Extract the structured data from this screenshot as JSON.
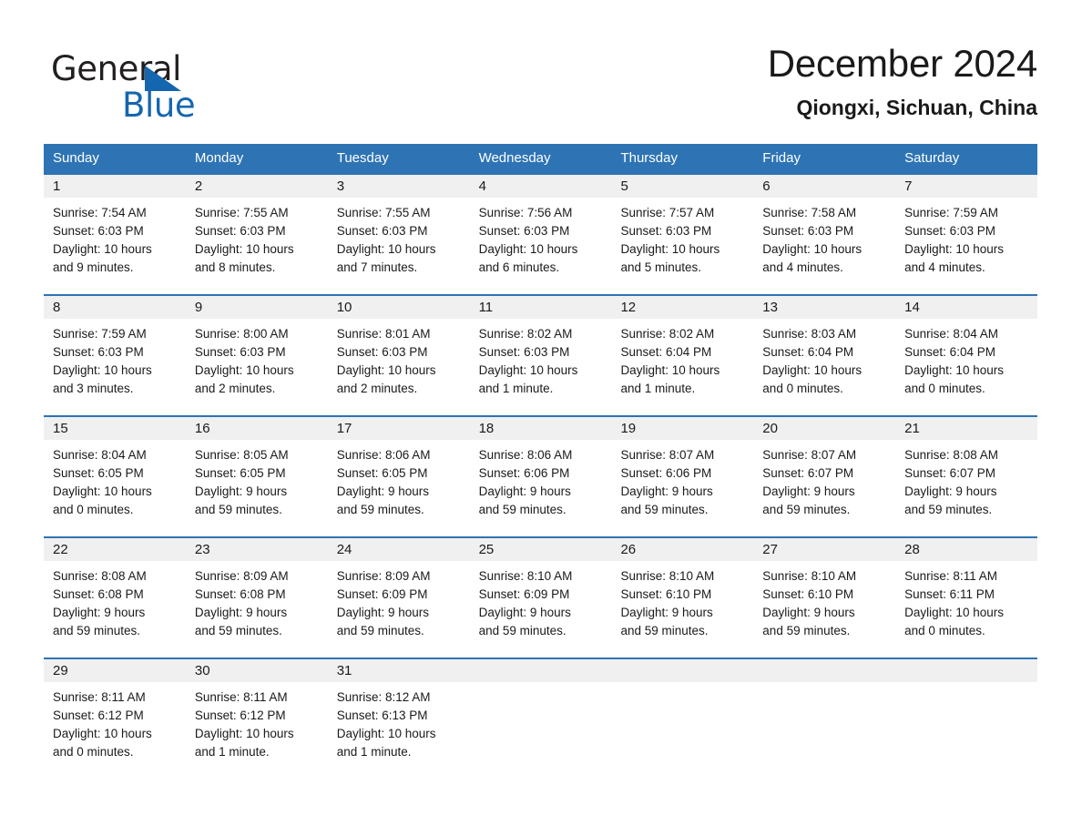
{
  "brand": {
    "name_part1": "General",
    "name_part2": "Blue",
    "triangle_color": "#1566b0",
    "logo_icon": "triangle-logo-icon"
  },
  "header": {
    "title": "December 2024",
    "subtitle": "Qiongxi, Sichuan, China"
  },
  "theme": {
    "header_blue": "#2e74b5",
    "daynum_band": "#f0f0f0",
    "text": "#1a1a1a"
  },
  "weekdays": [
    "Sunday",
    "Monday",
    "Tuesday",
    "Wednesday",
    "Thursday",
    "Friday",
    "Saturday"
  ],
  "weeks": [
    [
      {
        "day": "1",
        "sunrise": "Sunrise: 7:54 AM",
        "sunset": "Sunset: 6:03 PM",
        "daylight1": "Daylight: 10 hours",
        "daylight2": "and 9 minutes."
      },
      {
        "day": "2",
        "sunrise": "Sunrise: 7:55 AM",
        "sunset": "Sunset: 6:03 PM",
        "daylight1": "Daylight: 10 hours",
        "daylight2": "and 8 minutes."
      },
      {
        "day": "3",
        "sunrise": "Sunrise: 7:55 AM",
        "sunset": "Sunset: 6:03 PM",
        "daylight1": "Daylight: 10 hours",
        "daylight2": "and 7 minutes."
      },
      {
        "day": "4",
        "sunrise": "Sunrise: 7:56 AM",
        "sunset": "Sunset: 6:03 PM",
        "daylight1": "Daylight: 10 hours",
        "daylight2": "and 6 minutes."
      },
      {
        "day": "5",
        "sunrise": "Sunrise: 7:57 AM",
        "sunset": "Sunset: 6:03 PM",
        "daylight1": "Daylight: 10 hours",
        "daylight2": "and 5 minutes."
      },
      {
        "day": "6",
        "sunrise": "Sunrise: 7:58 AM",
        "sunset": "Sunset: 6:03 PM",
        "daylight1": "Daylight: 10 hours",
        "daylight2": "and 4 minutes."
      },
      {
        "day": "7",
        "sunrise": "Sunrise: 7:59 AM",
        "sunset": "Sunset: 6:03 PM",
        "daylight1": "Daylight: 10 hours",
        "daylight2": "and 4 minutes."
      }
    ],
    [
      {
        "day": "8",
        "sunrise": "Sunrise: 7:59 AM",
        "sunset": "Sunset: 6:03 PM",
        "daylight1": "Daylight: 10 hours",
        "daylight2": "and 3 minutes."
      },
      {
        "day": "9",
        "sunrise": "Sunrise: 8:00 AM",
        "sunset": "Sunset: 6:03 PM",
        "daylight1": "Daylight: 10 hours",
        "daylight2": "and 2 minutes."
      },
      {
        "day": "10",
        "sunrise": "Sunrise: 8:01 AM",
        "sunset": "Sunset: 6:03 PM",
        "daylight1": "Daylight: 10 hours",
        "daylight2": "and 2 minutes."
      },
      {
        "day": "11",
        "sunrise": "Sunrise: 8:02 AM",
        "sunset": "Sunset: 6:03 PM",
        "daylight1": "Daylight: 10 hours",
        "daylight2": "and 1 minute."
      },
      {
        "day": "12",
        "sunrise": "Sunrise: 8:02 AM",
        "sunset": "Sunset: 6:04 PM",
        "daylight1": "Daylight: 10 hours",
        "daylight2": "and 1 minute."
      },
      {
        "day": "13",
        "sunrise": "Sunrise: 8:03 AM",
        "sunset": "Sunset: 6:04 PM",
        "daylight1": "Daylight: 10 hours",
        "daylight2": "and 0 minutes."
      },
      {
        "day": "14",
        "sunrise": "Sunrise: 8:04 AM",
        "sunset": "Sunset: 6:04 PM",
        "daylight1": "Daylight: 10 hours",
        "daylight2": "and 0 minutes."
      }
    ],
    [
      {
        "day": "15",
        "sunrise": "Sunrise: 8:04 AM",
        "sunset": "Sunset: 6:05 PM",
        "daylight1": "Daylight: 10 hours",
        "daylight2": "and 0 minutes."
      },
      {
        "day": "16",
        "sunrise": "Sunrise: 8:05 AM",
        "sunset": "Sunset: 6:05 PM",
        "daylight1": "Daylight: 9 hours",
        "daylight2": "and 59 minutes."
      },
      {
        "day": "17",
        "sunrise": "Sunrise: 8:06 AM",
        "sunset": "Sunset: 6:05 PM",
        "daylight1": "Daylight: 9 hours",
        "daylight2": "and 59 minutes."
      },
      {
        "day": "18",
        "sunrise": "Sunrise: 8:06 AM",
        "sunset": "Sunset: 6:06 PM",
        "daylight1": "Daylight: 9 hours",
        "daylight2": "and 59 minutes."
      },
      {
        "day": "19",
        "sunrise": "Sunrise: 8:07 AM",
        "sunset": "Sunset: 6:06 PM",
        "daylight1": "Daylight: 9 hours",
        "daylight2": "and 59 minutes."
      },
      {
        "day": "20",
        "sunrise": "Sunrise: 8:07 AM",
        "sunset": "Sunset: 6:07 PM",
        "daylight1": "Daylight: 9 hours",
        "daylight2": "and 59 minutes."
      },
      {
        "day": "21",
        "sunrise": "Sunrise: 8:08 AM",
        "sunset": "Sunset: 6:07 PM",
        "daylight1": "Daylight: 9 hours",
        "daylight2": "and 59 minutes."
      }
    ],
    [
      {
        "day": "22",
        "sunrise": "Sunrise: 8:08 AM",
        "sunset": "Sunset: 6:08 PM",
        "daylight1": "Daylight: 9 hours",
        "daylight2": "and 59 minutes."
      },
      {
        "day": "23",
        "sunrise": "Sunrise: 8:09 AM",
        "sunset": "Sunset: 6:08 PM",
        "daylight1": "Daylight: 9 hours",
        "daylight2": "and 59 minutes."
      },
      {
        "day": "24",
        "sunrise": "Sunrise: 8:09 AM",
        "sunset": "Sunset: 6:09 PM",
        "daylight1": "Daylight: 9 hours",
        "daylight2": "and 59 minutes."
      },
      {
        "day": "25",
        "sunrise": "Sunrise: 8:10 AM",
        "sunset": "Sunset: 6:09 PM",
        "daylight1": "Daylight: 9 hours",
        "daylight2": "and 59 minutes."
      },
      {
        "day": "26",
        "sunrise": "Sunrise: 8:10 AM",
        "sunset": "Sunset: 6:10 PM",
        "daylight1": "Daylight: 9 hours",
        "daylight2": "and 59 minutes."
      },
      {
        "day": "27",
        "sunrise": "Sunrise: 8:10 AM",
        "sunset": "Sunset: 6:10 PM",
        "daylight1": "Daylight: 9 hours",
        "daylight2": "and 59 minutes."
      },
      {
        "day": "28",
        "sunrise": "Sunrise: 8:11 AM",
        "sunset": "Sunset: 6:11 PM",
        "daylight1": "Daylight: 10 hours",
        "daylight2": "and 0 minutes."
      }
    ],
    [
      {
        "day": "29",
        "sunrise": "Sunrise: 8:11 AM",
        "sunset": "Sunset: 6:12 PM",
        "daylight1": "Daylight: 10 hours",
        "daylight2": "and 0 minutes."
      },
      {
        "day": "30",
        "sunrise": "Sunrise: 8:11 AM",
        "sunset": "Sunset: 6:12 PM",
        "daylight1": "Daylight: 10 hours",
        "daylight2": "and 1 minute."
      },
      {
        "day": "31",
        "sunrise": "Sunrise: 8:12 AM",
        "sunset": "Sunset: 6:13 PM",
        "daylight1": "Daylight: 10 hours",
        "daylight2": "and 1 minute."
      },
      {
        "day": "",
        "sunrise": "",
        "sunset": "",
        "daylight1": "",
        "daylight2": ""
      },
      {
        "day": "",
        "sunrise": "",
        "sunset": "",
        "daylight1": "",
        "daylight2": ""
      },
      {
        "day": "",
        "sunrise": "",
        "sunset": "",
        "daylight1": "",
        "daylight2": ""
      },
      {
        "day": "",
        "sunrise": "",
        "sunset": "",
        "daylight1": "",
        "daylight2": ""
      }
    ]
  ]
}
